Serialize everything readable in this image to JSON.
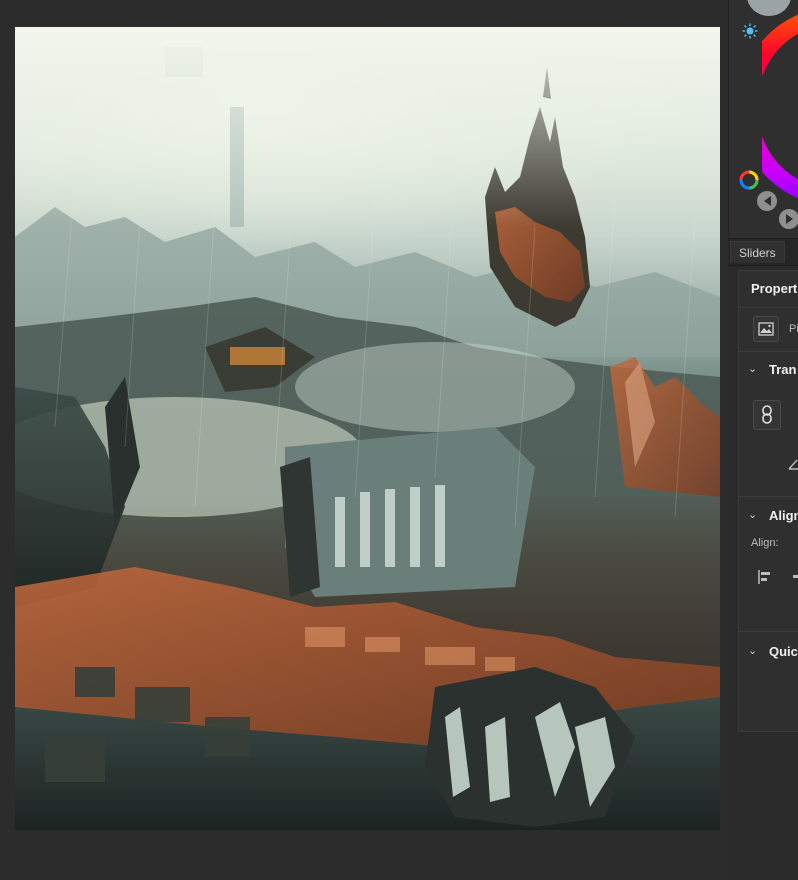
{
  "panel": {
    "tab_sliders": "Sliders",
    "properties_title": "Properti",
    "pixel_layer_label": "Pi",
    "sections": {
      "transform": "Tran",
      "align": "Align",
      "quick": "Quic"
    },
    "align_label": "Align:"
  },
  "colors": {
    "canvas_bg": "#2c2c2c",
    "panel_bg": "#2f2f2f",
    "accent_magenta": "#ff00c8"
  }
}
